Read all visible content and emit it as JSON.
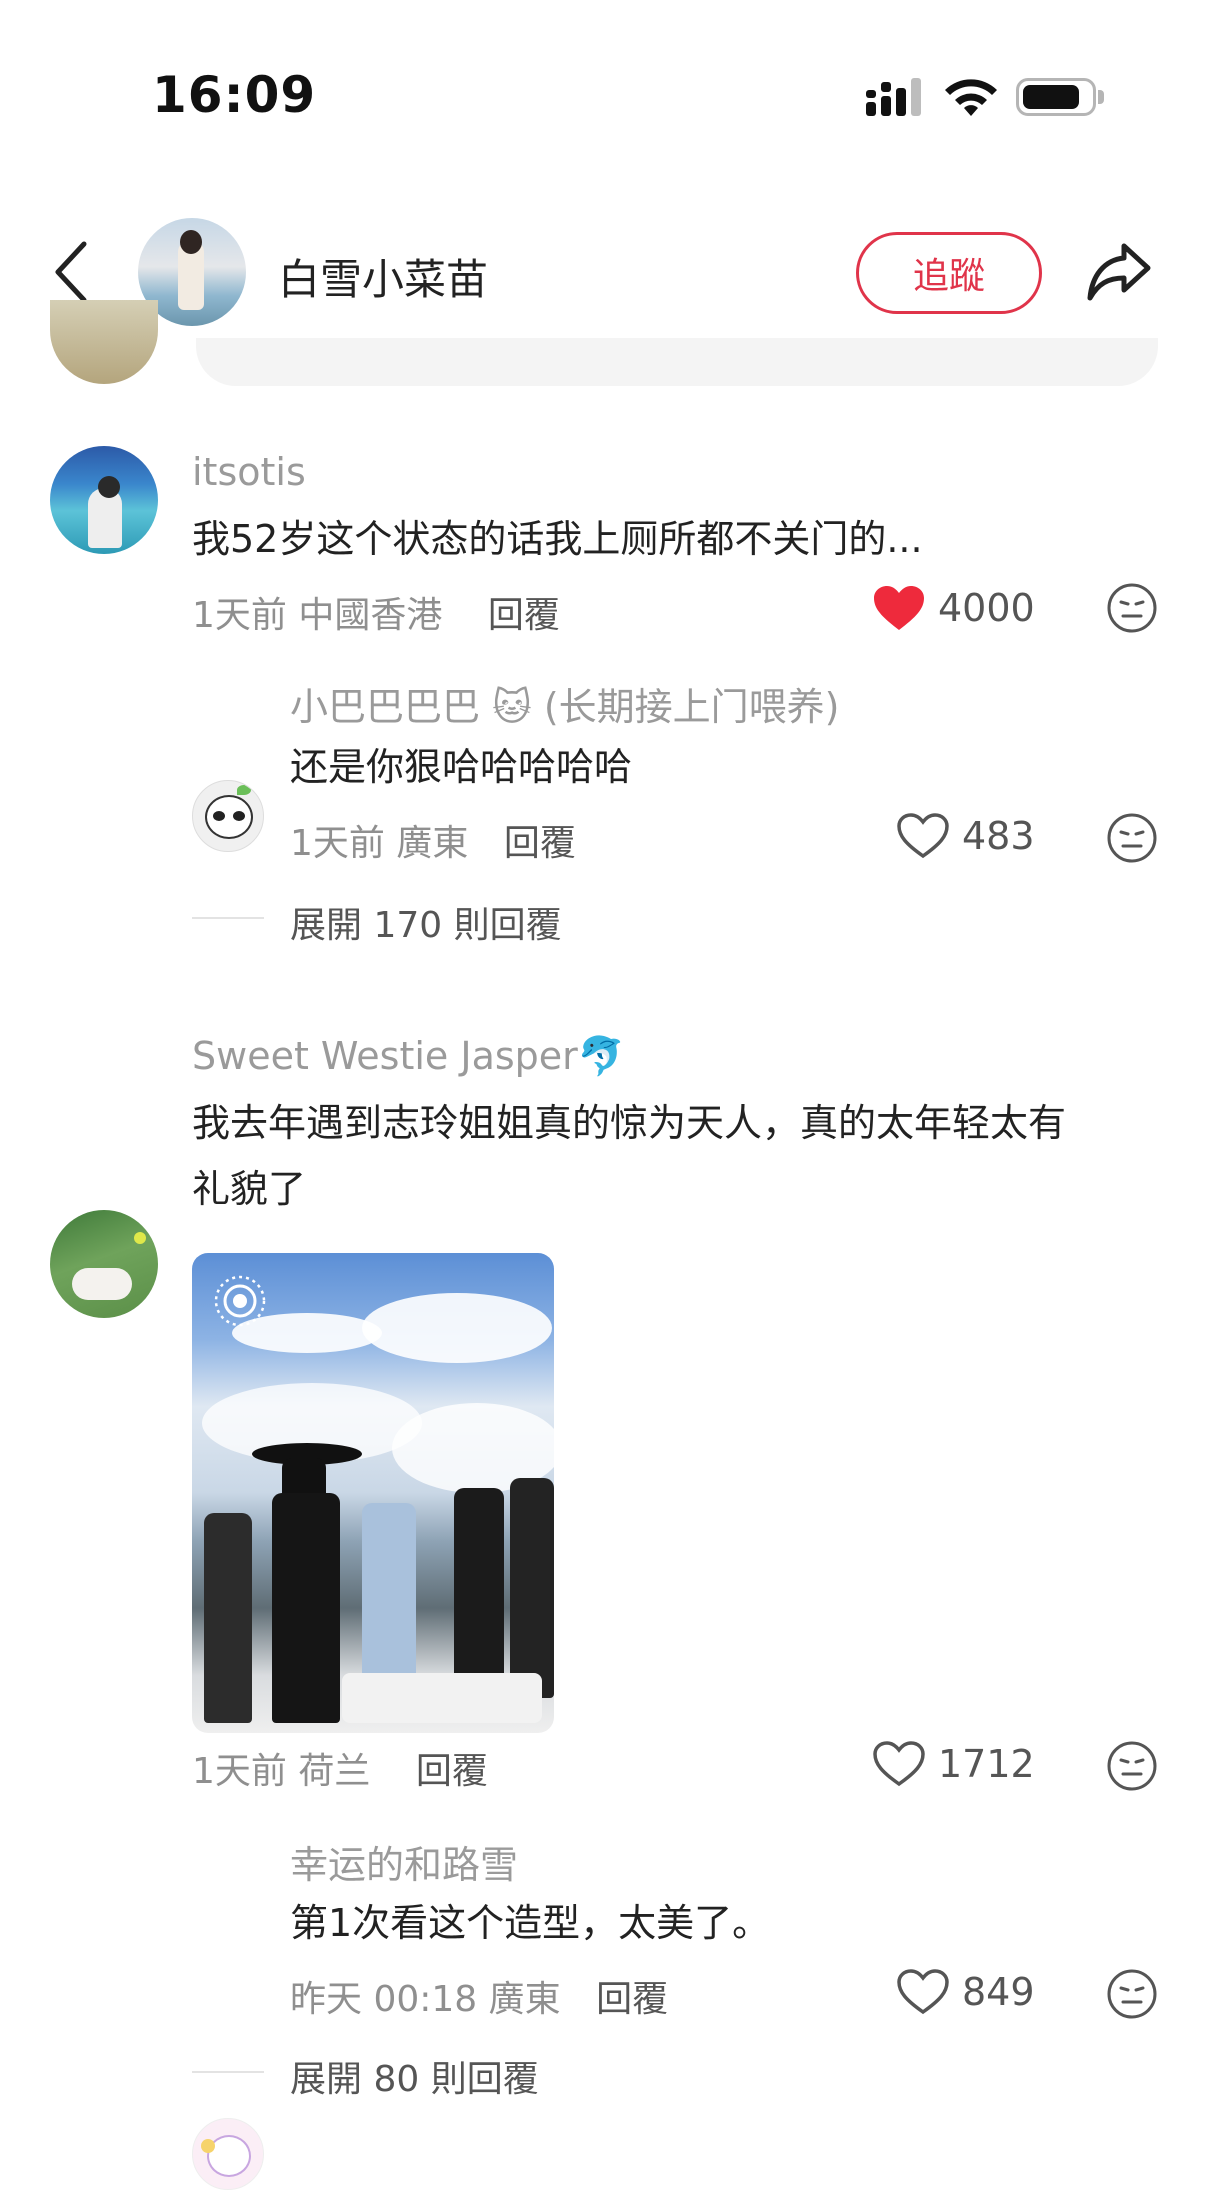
{
  "status_bar": {
    "time": "16:09"
  },
  "header": {
    "title": "白雪小菜苗",
    "follow_label": "追蹤"
  },
  "comments": [
    {
      "user": "itsotis",
      "text": "我52岁这个状态的话我上厕所都不关门的...",
      "time": "1天前",
      "location": "中國香港",
      "reply_label": "回覆",
      "likes": "4000",
      "liked": true,
      "replies": [
        {
          "user": "小巴巴巴巴",
          "user_emoji": "🐱",
          "user_suffix": "(长期接上门喂养)",
          "text": "还是你狠哈哈哈哈哈",
          "time": "1天前",
          "location": "廣東",
          "reply_label": "回覆",
          "likes": "483"
        }
      ],
      "expand_label": "展開 170 則回覆"
    },
    {
      "user": "Sweet Westie Jasper",
      "user_emoji": "🐬",
      "text_line1": "我去年遇到志玲姐姐真的惊为天人，真的太年轻太有",
      "text_line2": "礼貌了",
      "time": "1天前",
      "location": "荷兰",
      "reply_label": "回覆",
      "likes": "1712",
      "replies": [
        {
          "user": "幸运的和路雪",
          "text": "第1次看这个造型，太美了。",
          "time": "昨天 00:18",
          "location": "廣東",
          "reply_label": "回覆",
          "likes": "849"
        }
      ],
      "expand_label": "展開 80 則回覆"
    }
  ],
  "colors": {
    "accent": "#e0344a",
    "heart": "#ee2a3c",
    "muted": "#9a9a9a"
  },
  "icons": [
    "back-icon",
    "share-icon",
    "heart-icon",
    "dislike-face-icon",
    "signal-icon",
    "wifi-icon",
    "battery-icon",
    "live-photo-icon"
  ]
}
